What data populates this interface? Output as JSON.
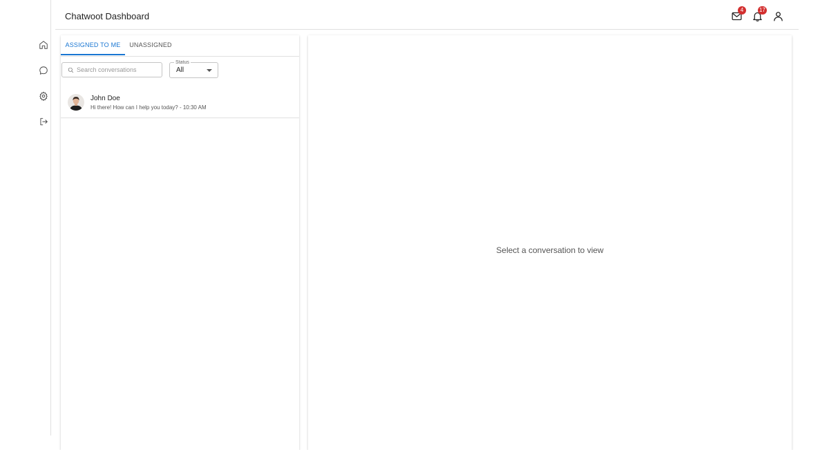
{
  "header": {
    "title": "Chatwoot Dashboard",
    "mail_badge": "4",
    "notifications_badge": "17"
  },
  "sidebar": {
    "items": [
      {
        "icon": "home-icon"
      },
      {
        "icon": "chat-icon"
      },
      {
        "icon": "gear-icon"
      },
      {
        "icon": "logout-icon"
      }
    ]
  },
  "conversation_list": {
    "tabs": [
      {
        "label": "ASSIGNED TO ME",
        "active": true
      },
      {
        "label": "UNASSIGNED",
        "active": false
      }
    ],
    "search": {
      "placeholder": "Search conversations",
      "value": ""
    },
    "status_filter": {
      "label": "Status",
      "value": "All"
    },
    "conversations": [
      {
        "name": "John Doe",
        "preview": "Hi there! How can I help you today? - 10:30 AM"
      }
    ]
  },
  "detail": {
    "empty_message": "Select a conversation to view"
  },
  "colors": {
    "accent": "#1976d2",
    "badge": "#d32f2f"
  }
}
